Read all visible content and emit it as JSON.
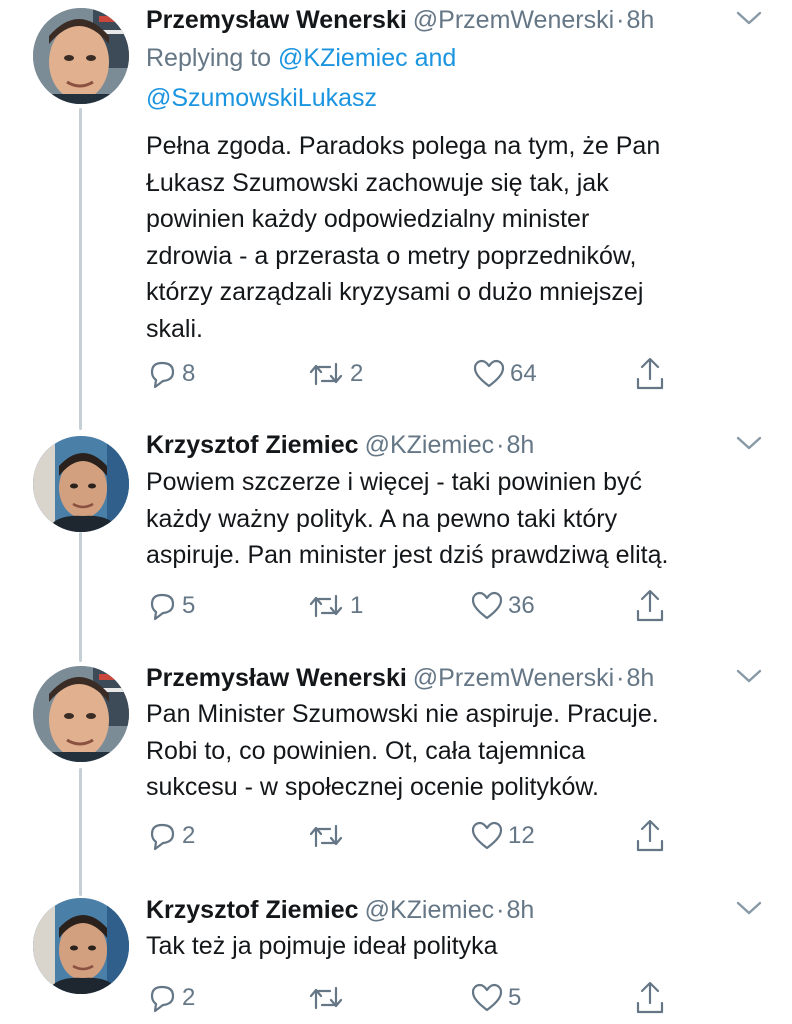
{
  "tweets": [
    {
      "author_name": "Przemysław Wenerski",
      "author_handle": "@PrzemWenerski",
      "time": "8h",
      "reply_prefix": "Replying to",
      "reply_mention_1": "@KZiemiec",
      "reply_and": "and",
      "reply_mention_2": "@SzumowskiLukasz",
      "text_lines": [
        "Pełna zgoda. Paradoks polega na tym, że Pan",
        "Łukasz Szumowski zachowuje się tak, jak",
        "powinien każdy odpowiedzialny minister",
        "zdrowia - a przerasta o metry poprzedników,",
        "którzy zarządzali kryzysami o dużo mniejszej",
        "skali."
      ],
      "replies": "8",
      "retweets": "2",
      "likes": "64"
    },
    {
      "author_name": "Krzysztof Ziemiec",
      "author_handle": "@KZiemiec",
      "time": "8h",
      "text_lines": [
        "Powiem szczerze i więcej - taki powinien być",
        "każdy ważny polityk. A na pewno taki który",
        "aspiruje. Pan minister jest dziś prawdziwą elitą."
      ],
      "replies": "5",
      "retweets": "1",
      "likes": "36"
    },
    {
      "author_name": "Przemysław Wenerski",
      "author_handle": "@PrzemWenerski",
      "time": "8h",
      "text_lines": [
        "Pan Minister Szumowski nie aspiruje. Pracuje.",
        "Robi to, co powinien. Ot, cała tajemnica",
        "sukcesu - w społecznej ocenie polityków."
      ],
      "replies": "2",
      "retweets": "",
      "likes": "12"
    },
    {
      "author_name": "Krzysztof Ziemiec",
      "author_handle": "@KZiemiec",
      "time": "8h",
      "text_lines": [
        "Tak też ja pojmuje ideał polityka"
      ],
      "replies": "2",
      "retweets": "",
      "likes": "5"
    }
  ],
  "time_separator": "·",
  "icons": {
    "reply": "reply-icon",
    "retweet": "retweet-icon",
    "like": "heart-icon",
    "share": "share-icon",
    "menu": "chevron-down-icon"
  },
  "colors": {
    "name": "#14171a",
    "secondary": "#657786",
    "link": "#1b95e0",
    "thread_line": "#c4cfd6"
  }
}
